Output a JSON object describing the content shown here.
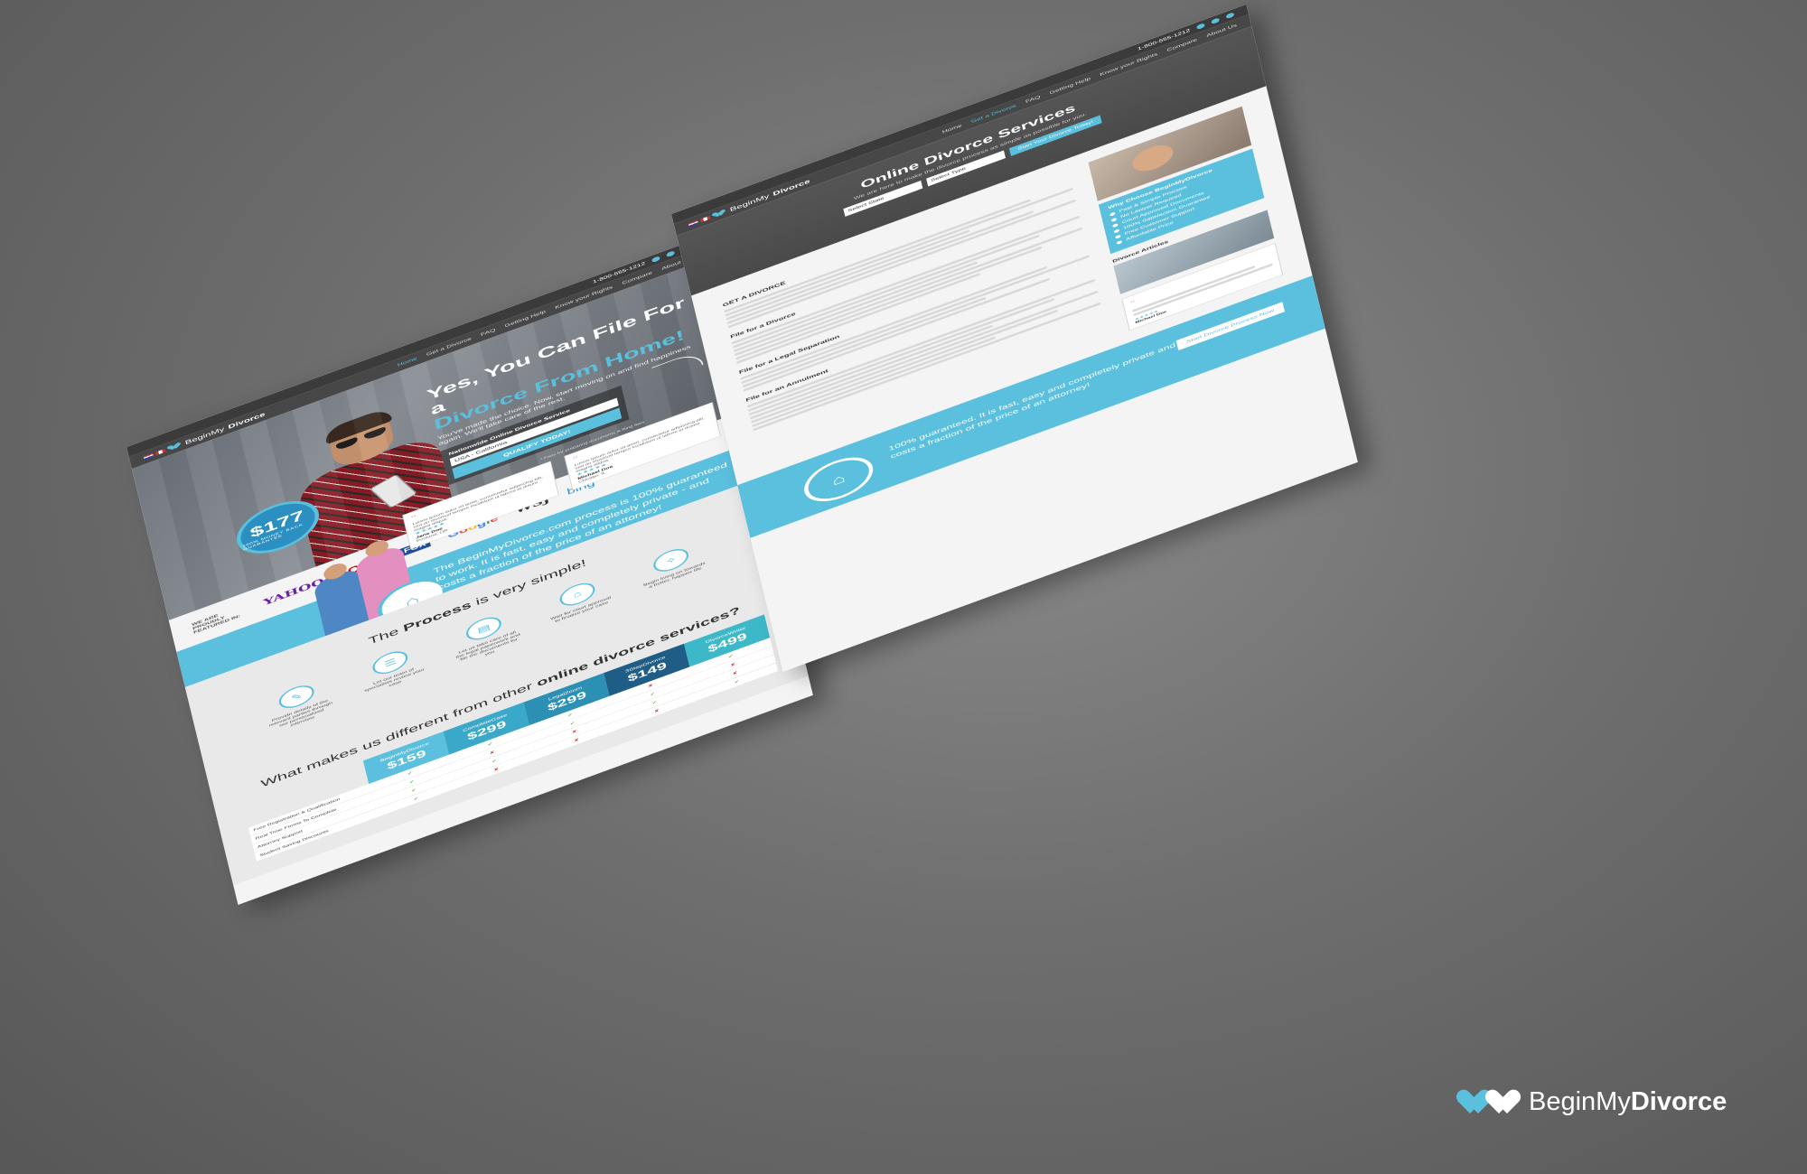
{
  "left_page": {
    "topbar": {
      "phone": "1-800-555-1212"
    },
    "nav": {
      "logo_regular": "BeginMy",
      "logo_bold": "Divorce",
      "links": [
        "Home",
        "Get a Divorce",
        "FAQ",
        "Getting Help",
        "Know your Rights",
        "Compare",
        "About Us"
      ]
    },
    "hero": {
      "title_line1": "Yes, You Can File For a",
      "title_line2": "Divorce From Home!",
      "subtitle": "You've made the choice. Now, start moving on and find happiness again. We'll take care of the rest.",
      "form_title": "Nationwide Online Divorce Service",
      "state_select": "USA - California",
      "cta": "QUALIFY TODAY!",
      "note": "* Fees for preparing documents & filing fees",
      "badge_price": "$177",
      "badge_caption": "100% MONEY BACK GUARANTEE"
    },
    "featured": {
      "label": "WE ARE PROUDLY FEATURED IN:",
      "brands": [
        "YAHOO!",
        "CNN",
        "FOX",
        "Google",
        "WSJ",
        "bing"
      ]
    },
    "testimonials": [
      {
        "text": "Lorem ipsum dolor sit amet, consectetur adipiscing elit, sed do eiusmod tempor incididunt ut labore et dolore magna aliqua.",
        "name": "Jane Doe",
        "place": "Portland, OR"
      },
      {
        "text": "Lorem ipsum dolor sit amet, consectetur adipiscing elit, sed do eiusmod tempor incididunt ut labore et dolore magna aliqua.",
        "name": "Michael Doe",
        "place": "Chicago, IL"
      }
    ],
    "guarantee_text": "The BeginMyDivorce.com process is 100% guaranteed to work. It is fast, easy and completely private - and costs a fraction of the price of an attorney!",
    "process": {
      "title_regular": "The ",
      "title_bold": "Process",
      "title_rest": " is very simple!",
      "steps": [
        "Provide details of the relevant parties through our personalized interview",
        "Let our team of specialists review your case",
        "Let us take care of all the legal paperwork and file the documents for you",
        "Wait for court approval to finalize your case",
        "Begin living on towards a better, happier life"
      ]
    },
    "compare": {
      "title_regular": "What makes us different from other ",
      "title_bold": "online divorce services?",
      "columns": [
        {
          "name": "BeginMyDivorce",
          "price": "$159"
        },
        {
          "name": "CompleteCase",
          "price": "$299"
        },
        {
          "name": "LegalZoom",
          "price": "$299"
        },
        {
          "name": "3StepDivorce",
          "price": "$149"
        },
        {
          "name": "DivorceWriter",
          "price": "$499"
        }
      ],
      "rows": [
        {
          "label": "Free Registration & Qualification",
          "marks": [
            "✔",
            "✔",
            "✔",
            "✘",
            "✔"
          ]
        },
        {
          "label": "Real Time Forms To Complete",
          "marks": [
            "✔",
            "✘",
            "✔",
            "✔",
            "✘"
          ]
        },
        {
          "label": "Attorney Support",
          "marks": [
            "✔",
            "✔",
            "✘",
            "✔",
            "✘"
          ]
        },
        {
          "label": "Student Saving Discounts",
          "marks": [
            "✔",
            "✘",
            "✘",
            "✘",
            "✔"
          ]
        }
      ]
    }
  },
  "right_page": {
    "topbar": {
      "phone": "1-800-555-1212"
    },
    "nav": {
      "logo_regular": "BeginMy",
      "logo_bold": "Divorce",
      "links": [
        "Home",
        "Get a Divorce",
        "FAQ",
        "Getting Help",
        "Know your Rights",
        "Compare",
        "About Us"
      ]
    },
    "hero": {
      "title": "Online Divorce Services",
      "subtitle": "We are here to make the divorce process as simple as possible for you.",
      "select1": "Select State",
      "select2": "Select Type",
      "cta": "Start Your Divorce Today!"
    },
    "main": {
      "headings": [
        "GET A DIVORCE",
        "File for a Divorce",
        "File for a Legal Separation",
        "File for an Annulment"
      ]
    },
    "sidebar": {
      "why_title": "Why Choose BeginMyDivorce",
      "why_items": [
        "Fast & Simple Process",
        "No Lawyer Required",
        "Court Approved Documents",
        "100% Satisfaction Guarantee",
        "Free Customer Support",
        "Affordable Price"
      ],
      "articles_title": "Divorce Articles",
      "testimonial_name": "Michael Doe"
    },
    "footer": {
      "text": "100% guaranteed. It is fast, easy and completely private and costs a fraction of the price of an attorney!",
      "cta": "Start Divorce Process Now"
    }
  },
  "watermark": {
    "regular": "BeginMy",
    "bold": "Divorce"
  },
  "colors": {
    "accent": "#5bc0de",
    "dark": "#3b3b3b",
    "background": "#6f6f6f"
  }
}
